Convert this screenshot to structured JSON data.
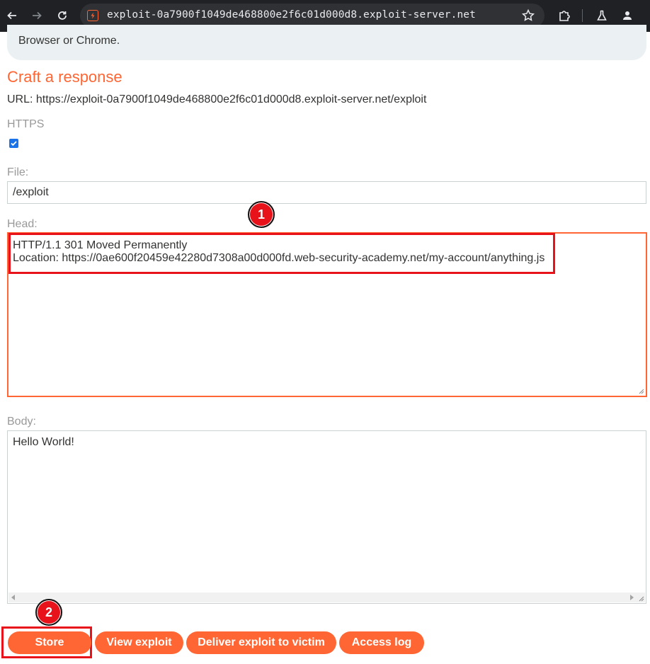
{
  "browser": {
    "url": "exploit-0a7900f1049de468800e2f6c01d000d8.exploit-server.net",
    "colors": {
      "toolbar": "#202124",
      "omnibox": "#303134"
    }
  },
  "page": {
    "banner_text": "Browser or Chrome.",
    "heading": "Craft a response",
    "url_line": "URL: https://exploit-0a7900f1049de468800e2f6c01d000d8.exploit-server.net/exploit",
    "https_label": "HTTPS",
    "https_checked": true,
    "file_label": "File:",
    "file_value": "/exploit",
    "head_label": "Head:",
    "head_value": "HTTP/1.1 301 Moved Permanently\nLocation: https://0ae600f20459e42280d7308a00d000fd.web-security-academy.net/my-account/anything.js",
    "body_label": "Body:",
    "body_value": "Hello World!",
    "buttons": {
      "store": "Store",
      "view": "View exploit",
      "deliver": "Deliver exploit to victim",
      "log": "Access log"
    },
    "colors": {
      "accent": "#ff6633",
      "annotation": "#e8121b"
    }
  },
  "annotations": {
    "step1": "1",
    "step2": "2"
  }
}
